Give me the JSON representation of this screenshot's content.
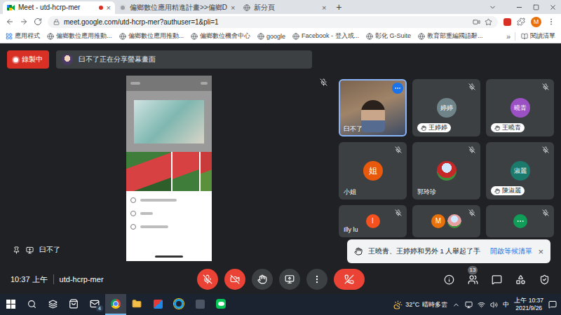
{
  "browser": {
    "tabs": [
      {
        "title": "Meet - utd-hcrp-mer",
        "kind": "meet",
        "selected": true,
        "recording": true
      },
      {
        "title": "偏鄉數位應用精進計畫>>偏鄉D",
        "kind": "site",
        "selected": false,
        "recording": false
      },
      {
        "title": "新分頁",
        "kind": "newtab",
        "selected": false,
        "recording": false
      }
    ],
    "tab_close": "×",
    "new_tab": "+",
    "url": "meet.google.com/utd-hcrp-mer?authuser=1&pli=1",
    "bookmarked": false,
    "profile": "M",
    "apps": "應用程式",
    "bookmarks": [
      "偏鄉數位應用推動...",
      "偏鄉數位應用推動...",
      "偏鄉數位機會中心",
      "google",
      "Facebook - 登入或...",
      "彰化 G-Suite",
      "教育部重編國語辭..."
    ],
    "bookmarks_more": "»",
    "reading_list": "閱讀清單"
  },
  "meet": {
    "recording": "錄製中",
    "presenting": "臼不了正在分享螢幕畫面",
    "presenter": "臼不了",
    "stage_muted": true,
    "participants": [
      {
        "name": "臼不了",
        "kind": "video",
        "initials": "",
        "color": "#7a6350",
        "muted": false,
        "hand_raised": false,
        "speaking": true,
        "hovered": true
      },
      {
        "name": "王婷婷",
        "kind": "initials",
        "initials": "婷婷",
        "color": "#6e8488",
        "muted": true,
        "hand_raised": true,
        "speaking": false,
        "hovered": false
      },
      {
        "name": "王曉青",
        "kind": "initials",
        "initials": "曉青",
        "color": "#9b51c4",
        "muted": true,
        "hand_raised": true,
        "speaking": false,
        "hovered": false
      },
      {
        "name": "小姐",
        "kind": "initials",
        "initials": "姐",
        "color": "#e8590c",
        "muted": true,
        "hand_raised": false,
        "speaking": false,
        "hovered": false
      },
      {
        "name": "郭玲珍",
        "kind": "photo",
        "initials": "",
        "color": "#c62828",
        "muted": true,
        "hand_raised": false,
        "speaking": false,
        "hovered": false
      },
      {
        "name": "陳淑麗",
        "kind": "initials",
        "initials": "淑麗",
        "color": "#1b7a6c",
        "muted": true,
        "hand_raised": true,
        "speaking": false,
        "hovered": false
      },
      {
        "name": "Illy lu",
        "kind": "initials",
        "initials": "I",
        "color": "#f4511e",
        "muted": true,
        "hand_raised": false,
        "speaking": false,
        "hovered": false
      },
      {
        "name": "",
        "kind": "group",
        "initials": "M",
        "color": "#e8710a",
        "muted": true,
        "hand_raised": false,
        "speaking": false,
        "hovered": false
      },
      {
        "name": "",
        "kind": "logo",
        "initials": "",
        "color": "#0f9d58",
        "muted": true,
        "hand_raised": false,
        "speaking": false,
        "hovered": false
      }
    ],
    "notification": {
      "text": "王曉青、王婷婷和另外 1 人舉起了手",
      "action": "開啟等候清單",
      "close": "×"
    },
    "time": "10:37 上午",
    "meeting_code": "utd-hcrp-mer",
    "controls": [
      {
        "kind": "mic",
        "on": false
      },
      {
        "kind": "camera",
        "on": false
      },
      {
        "kind": "hand",
        "on": false
      },
      {
        "kind": "present"
      },
      {
        "kind": "more"
      },
      {
        "kind": "leave"
      }
    ],
    "side_buttons": [
      {
        "kind": "info",
        "badge": ""
      },
      {
        "kind": "people",
        "badge": "13"
      },
      {
        "kind": "chat",
        "badge": ""
      },
      {
        "kind": "activities",
        "badge": ""
      },
      {
        "kind": "host",
        "badge": ""
      }
    ]
  },
  "taskbar": {
    "apps": [
      {
        "kind": "store",
        "active": false,
        "badge": ""
      },
      {
        "kind": "mail",
        "active": false,
        "badge": "4"
      },
      {
        "kind": "chrome",
        "active": true,
        "badge": ""
      },
      {
        "kind": "explorer",
        "active": false,
        "badge": ""
      },
      {
        "kind": "remote",
        "active": false,
        "badge": ""
      },
      {
        "kind": "ie",
        "active": false,
        "badge": ""
      },
      {
        "kind": "terminal",
        "active": false,
        "badge": ""
      },
      {
        "kind": "line",
        "active": false,
        "badge": ""
      }
    ],
    "weather": {
      "temp": "32°C",
      "desc": "晴時多雲"
    },
    "ime": "中",
    "time": "上午 10:37",
    "date": "2021/9/26"
  }
}
